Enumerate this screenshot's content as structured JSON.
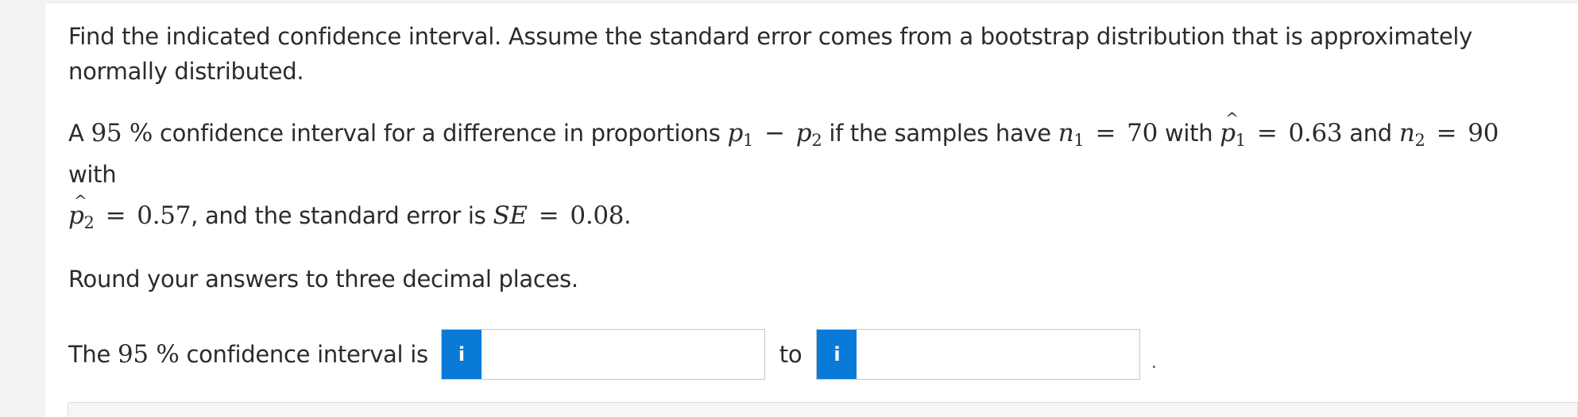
{
  "problem": {
    "intro": "Find the indicated confidence interval. Assume the standard error comes from a bootstrap distribution that is approximately normally distributed.",
    "question": {
      "t1": "A",
      "conf_level": "95 %",
      "t2": "confidence interval for a difference in proportions",
      "p1_sym": "p",
      "p1_sub": "1",
      "minus": "−",
      "p2_sym": "p",
      "p2_sub": "2",
      "t3": "if the samples have",
      "n1_sym": "n",
      "n1_sub": "1",
      "eq1": "=",
      "n1_val": "70",
      "t4": "with",
      "ph1_sym": "p",
      "ph1_sub": "1",
      "eq2": "=",
      "ph1_val": "0.63",
      "t5": "and",
      "n2_sym": "n",
      "n2_sub": "2",
      "eq3": "=",
      "n2_val": "90",
      "t6": "with",
      "ph2_sym": "p",
      "ph2_sub": "2",
      "eq4": "=",
      "ph2_val": "0.57",
      "t7": ", and the standard error is",
      "se_sym": "SE",
      "eq5": "=",
      "se_val": "0.08",
      "t8": "."
    },
    "rounding": "Round your answers to three decimal places."
  },
  "answer": {
    "lead": "The",
    "conf_level": "95 %",
    "lead_rest": "confidence interval is",
    "info_icon_glyph": "i",
    "lower_value": "",
    "to_label": "to",
    "upper_value": "",
    "period": "."
  },
  "colors": {
    "info_button": "#0a7ad9",
    "text": "#2b2b2b"
  }
}
